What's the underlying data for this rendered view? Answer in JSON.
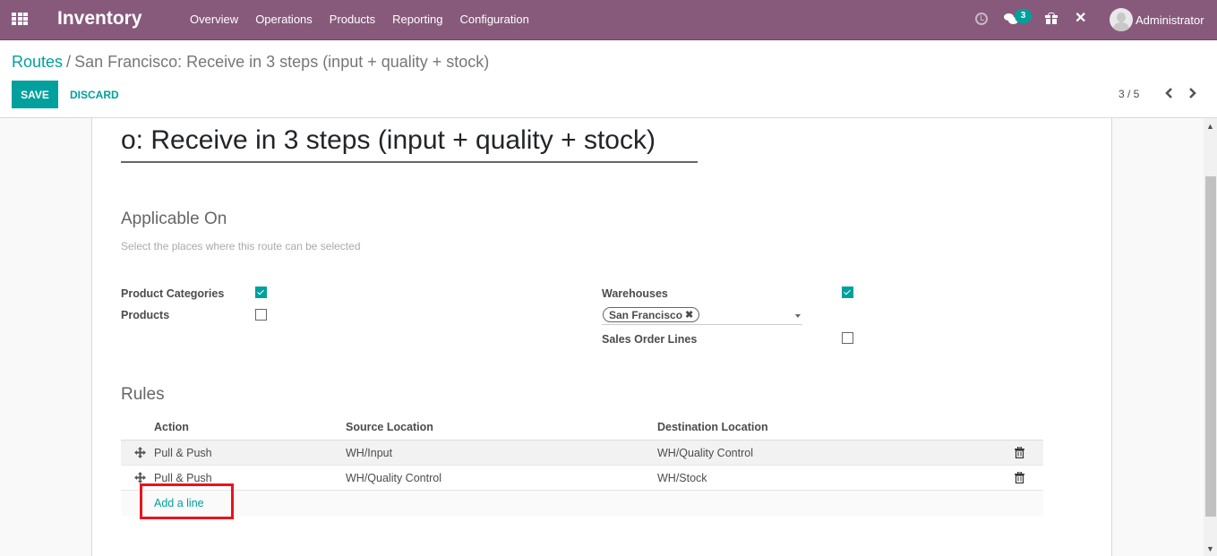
{
  "navbar": {
    "app_name": "Inventory",
    "menu": [
      "Overview",
      "Operations",
      "Products",
      "Reporting",
      "Configuration"
    ],
    "icons": [
      "apps-grid-icon",
      "clock-icon",
      "chat-icon",
      "gift-icon",
      "tools-icon"
    ],
    "message_count": "3",
    "user_name": "Administrator"
  },
  "breadcrumb": {
    "parent": "Routes",
    "separator": "/",
    "current": "San Francisco: Receive in 3 steps (input + quality + stock)"
  },
  "toolbar": {
    "save_label": "SAVE",
    "discard_label": "DISCARD"
  },
  "pager": {
    "value": "3 / 5"
  },
  "form": {
    "route_name_visible": "o: Receive in 3 steps (input + quality + stock)",
    "applicable_on": {
      "title": "Applicable On",
      "subtitle": "Select the places where this route can be selected",
      "product_categories": {
        "label": "Product Categories",
        "checked": true
      },
      "products": {
        "label": "Products",
        "checked": false
      },
      "warehouses": {
        "label": "Warehouses",
        "checked": true,
        "tags": [
          "San Francisco"
        ]
      },
      "sales_order_lines": {
        "label": "Sales Order Lines",
        "checked": false
      }
    },
    "rules": {
      "title": "Rules",
      "columns": [
        "Action",
        "Source Location",
        "Destination Location"
      ],
      "rows": [
        {
          "action": "Pull & Push",
          "source": "WH/Input",
          "destination": "WH/Quality Control"
        },
        {
          "action": "Pull & Push",
          "source": "WH/Quality Control",
          "destination": "WH/Stock"
        }
      ],
      "add_line_label": "Add a line"
    }
  },
  "colors": {
    "navbar": "#875a7b",
    "accent": "#00a09d",
    "highlight": "#e8141b"
  }
}
